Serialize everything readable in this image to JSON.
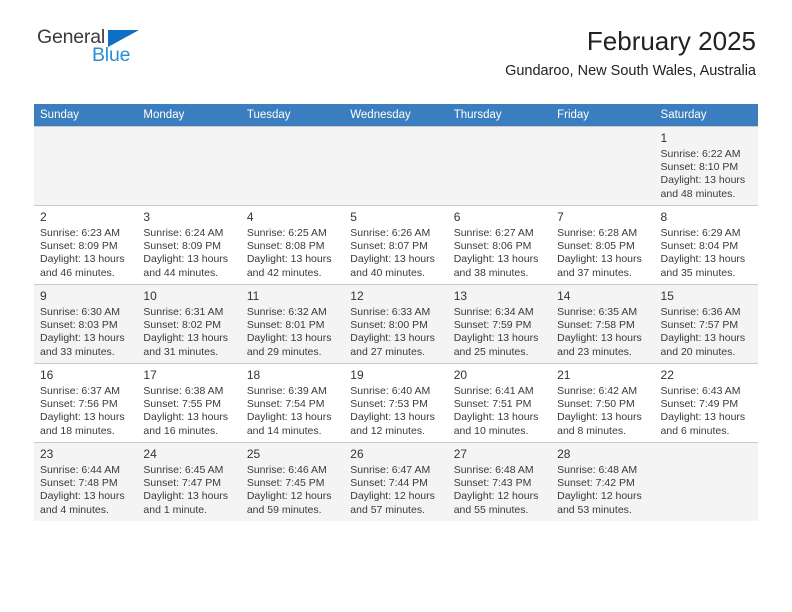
{
  "brand": {
    "name_part1": "General",
    "name_part2": "Blue",
    "triangle_color": "#0f6fc5",
    "blue_color": "#2b8fd4"
  },
  "header": {
    "title": "February 2025",
    "subtitle": "Gundaroo, New South Wales, Australia"
  },
  "theme": {
    "header_row_bg": "#3a7ebf",
    "shaded_row_bg": "#f4f4f4",
    "grid_line": "#c8c8c8"
  },
  "calendar": {
    "weekday_headers": [
      "Sunday",
      "Monday",
      "Tuesday",
      "Wednesday",
      "Thursday",
      "Friday",
      "Saturday"
    ],
    "weeks": [
      [
        {
          "day": "",
          "sunrise": "",
          "sunset": "",
          "daylight_line1": "",
          "daylight_line2": ""
        },
        {
          "day": "",
          "sunrise": "",
          "sunset": "",
          "daylight_line1": "",
          "daylight_line2": ""
        },
        {
          "day": "",
          "sunrise": "",
          "sunset": "",
          "daylight_line1": "",
          "daylight_line2": ""
        },
        {
          "day": "",
          "sunrise": "",
          "sunset": "",
          "daylight_line1": "",
          "daylight_line2": ""
        },
        {
          "day": "",
          "sunrise": "",
          "sunset": "",
          "daylight_line1": "",
          "daylight_line2": ""
        },
        {
          "day": "",
          "sunrise": "",
          "sunset": "",
          "daylight_line1": "",
          "daylight_line2": ""
        },
        {
          "day": "1",
          "sunrise": "Sunrise: 6:22 AM",
          "sunset": "Sunset: 8:10 PM",
          "daylight_line1": "Daylight: 13 hours",
          "daylight_line2": "and 48 minutes."
        }
      ],
      [
        {
          "day": "2",
          "sunrise": "Sunrise: 6:23 AM",
          "sunset": "Sunset: 8:09 PM",
          "daylight_line1": "Daylight: 13 hours",
          "daylight_line2": "and 46 minutes."
        },
        {
          "day": "3",
          "sunrise": "Sunrise: 6:24 AM",
          "sunset": "Sunset: 8:09 PM",
          "daylight_line1": "Daylight: 13 hours",
          "daylight_line2": "and 44 minutes."
        },
        {
          "day": "4",
          "sunrise": "Sunrise: 6:25 AM",
          "sunset": "Sunset: 8:08 PM",
          "daylight_line1": "Daylight: 13 hours",
          "daylight_line2": "and 42 minutes."
        },
        {
          "day": "5",
          "sunrise": "Sunrise: 6:26 AM",
          "sunset": "Sunset: 8:07 PM",
          "daylight_line1": "Daylight: 13 hours",
          "daylight_line2": "and 40 minutes."
        },
        {
          "day": "6",
          "sunrise": "Sunrise: 6:27 AM",
          "sunset": "Sunset: 8:06 PM",
          "daylight_line1": "Daylight: 13 hours",
          "daylight_line2": "and 38 minutes."
        },
        {
          "day": "7",
          "sunrise": "Sunrise: 6:28 AM",
          "sunset": "Sunset: 8:05 PM",
          "daylight_line1": "Daylight: 13 hours",
          "daylight_line2": "and 37 minutes."
        },
        {
          "day": "8",
          "sunrise": "Sunrise: 6:29 AM",
          "sunset": "Sunset: 8:04 PM",
          "daylight_line1": "Daylight: 13 hours",
          "daylight_line2": "and 35 minutes."
        }
      ],
      [
        {
          "day": "9",
          "sunrise": "Sunrise: 6:30 AM",
          "sunset": "Sunset: 8:03 PM",
          "daylight_line1": "Daylight: 13 hours",
          "daylight_line2": "and 33 minutes."
        },
        {
          "day": "10",
          "sunrise": "Sunrise: 6:31 AM",
          "sunset": "Sunset: 8:02 PM",
          "daylight_line1": "Daylight: 13 hours",
          "daylight_line2": "and 31 minutes."
        },
        {
          "day": "11",
          "sunrise": "Sunrise: 6:32 AM",
          "sunset": "Sunset: 8:01 PM",
          "daylight_line1": "Daylight: 13 hours",
          "daylight_line2": "and 29 minutes."
        },
        {
          "day": "12",
          "sunrise": "Sunrise: 6:33 AM",
          "sunset": "Sunset: 8:00 PM",
          "daylight_line1": "Daylight: 13 hours",
          "daylight_line2": "and 27 minutes."
        },
        {
          "day": "13",
          "sunrise": "Sunrise: 6:34 AM",
          "sunset": "Sunset: 7:59 PM",
          "daylight_line1": "Daylight: 13 hours",
          "daylight_line2": "and 25 minutes."
        },
        {
          "day": "14",
          "sunrise": "Sunrise: 6:35 AM",
          "sunset": "Sunset: 7:58 PM",
          "daylight_line1": "Daylight: 13 hours",
          "daylight_line2": "and 23 minutes."
        },
        {
          "day": "15",
          "sunrise": "Sunrise: 6:36 AM",
          "sunset": "Sunset: 7:57 PM",
          "daylight_line1": "Daylight: 13 hours",
          "daylight_line2": "and 20 minutes."
        }
      ],
      [
        {
          "day": "16",
          "sunrise": "Sunrise: 6:37 AM",
          "sunset": "Sunset: 7:56 PM",
          "daylight_line1": "Daylight: 13 hours",
          "daylight_line2": "and 18 minutes."
        },
        {
          "day": "17",
          "sunrise": "Sunrise: 6:38 AM",
          "sunset": "Sunset: 7:55 PM",
          "daylight_line1": "Daylight: 13 hours",
          "daylight_line2": "and 16 minutes."
        },
        {
          "day": "18",
          "sunrise": "Sunrise: 6:39 AM",
          "sunset": "Sunset: 7:54 PM",
          "daylight_line1": "Daylight: 13 hours",
          "daylight_line2": "and 14 minutes."
        },
        {
          "day": "19",
          "sunrise": "Sunrise: 6:40 AM",
          "sunset": "Sunset: 7:53 PM",
          "daylight_line1": "Daylight: 13 hours",
          "daylight_line2": "and 12 minutes."
        },
        {
          "day": "20",
          "sunrise": "Sunrise: 6:41 AM",
          "sunset": "Sunset: 7:51 PM",
          "daylight_line1": "Daylight: 13 hours",
          "daylight_line2": "and 10 minutes."
        },
        {
          "day": "21",
          "sunrise": "Sunrise: 6:42 AM",
          "sunset": "Sunset: 7:50 PM",
          "daylight_line1": "Daylight: 13 hours",
          "daylight_line2": "and 8 minutes."
        },
        {
          "day": "22",
          "sunrise": "Sunrise: 6:43 AM",
          "sunset": "Sunset: 7:49 PM",
          "daylight_line1": "Daylight: 13 hours",
          "daylight_line2": "and 6 minutes."
        }
      ],
      [
        {
          "day": "23",
          "sunrise": "Sunrise: 6:44 AM",
          "sunset": "Sunset: 7:48 PM",
          "daylight_line1": "Daylight: 13 hours",
          "daylight_line2": "and 4 minutes."
        },
        {
          "day": "24",
          "sunrise": "Sunrise: 6:45 AM",
          "sunset": "Sunset: 7:47 PM",
          "daylight_line1": "Daylight: 13 hours",
          "daylight_line2": "and 1 minute."
        },
        {
          "day": "25",
          "sunrise": "Sunrise: 6:46 AM",
          "sunset": "Sunset: 7:45 PM",
          "daylight_line1": "Daylight: 12 hours",
          "daylight_line2": "and 59 minutes."
        },
        {
          "day": "26",
          "sunrise": "Sunrise: 6:47 AM",
          "sunset": "Sunset: 7:44 PM",
          "daylight_line1": "Daylight: 12 hours",
          "daylight_line2": "and 57 minutes."
        },
        {
          "day": "27",
          "sunrise": "Sunrise: 6:48 AM",
          "sunset": "Sunset: 7:43 PM",
          "daylight_line1": "Daylight: 12 hours",
          "daylight_line2": "and 55 minutes."
        },
        {
          "day": "28",
          "sunrise": "Sunrise: 6:48 AM",
          "sunset": "Sunset: 7:42 PM",
          "daylight_line1": "Daylight: 12 hours",
          "daylight_line2": "and 53 minutes."
        },
        {
          "day": "",
          "sunrise": "",
          "sunset": "",
          "daylight_line1": "",
          "daylight_line2": ""
        }
      ]
    ]
  }
}
